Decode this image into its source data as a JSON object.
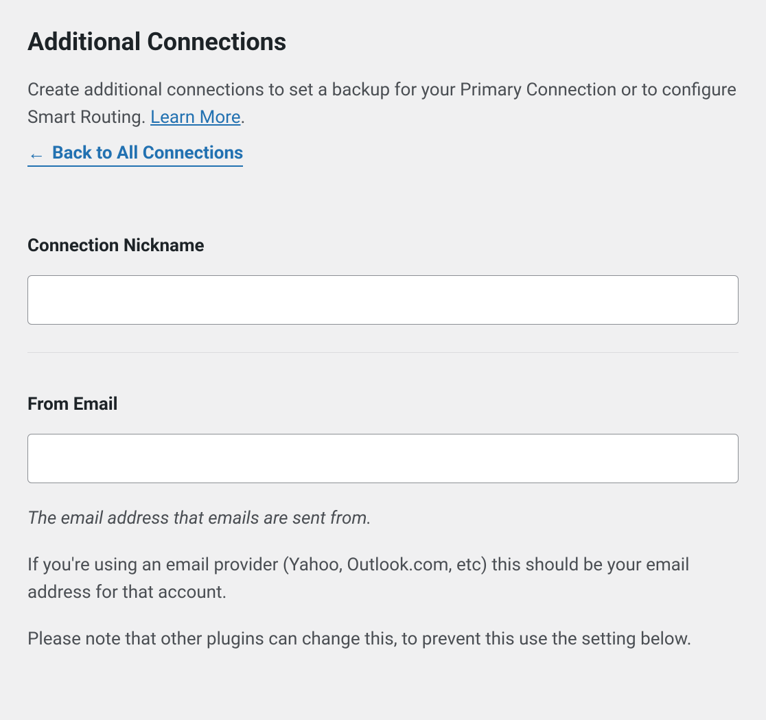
{
  "page": {
    "title": "Additional Connections",
    "description_prefix": "Create additional connections to set a backup for your Primary Connection or to configure Smart Routing. ",
    "learn_more_label": "Learn More",
    "description_suffix": ".",
    "back_link_label": "Back to All Connections"
  },
  "form": {
    "nickname": {
      "label": "Connection Nickname",
      "value": ""
    },
    "from_email": {
      "label": "From Email",
      "value": "",
      "help_italic": "The email address that emails are sent from.",
      "help_text_1": "If you're using an email provider (Yahoo, Outlook.com, etc) this should be your email address for that account.",
      "help_text_2": "Please note that other plugins can change this, to prevent this use the setting below."
    }
  }
}
